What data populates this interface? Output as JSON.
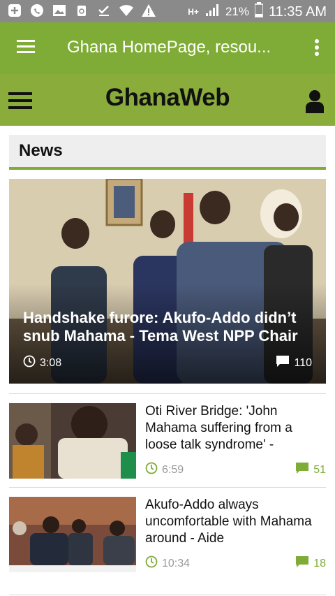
{
  "status_bar": {
    "network": "H+",
    "battery_percent": "21%",
    "time": "11:35 AM"
  },
  "app_bar": {
    "title": "Ghana HomePage, resou..."
  },
  "site_header": {
    "logo_text": "GhanaWeb"
  },
  "section": {
    "title": "News"
  },
  "featured": {
    "headline": "Handshake furore: Akufo-Addo didn’t snub Mahama - Tema West NPP Chair",
    "time": "3:08",
    "comments": "110"
  },
  "stories": [
    {
      "headline": "Oti River Bridge: 'John Mahama suffering from a loose talk syndrome' -",
      "time": "6:59",
      "comments": "51"
    },
    {
      "headline": "Akufo-Addo always uncomfortable with Mahama around - Aide",
      "time": "10:34",
      "comments": "18"
    }
  ],
  "colors": {
    "status_bar": "#8a8a8a",
    "app_bar": "#7fac37",
    "site_header": "#8aac3a",
    "accent": "#7fac37"
  }
}
